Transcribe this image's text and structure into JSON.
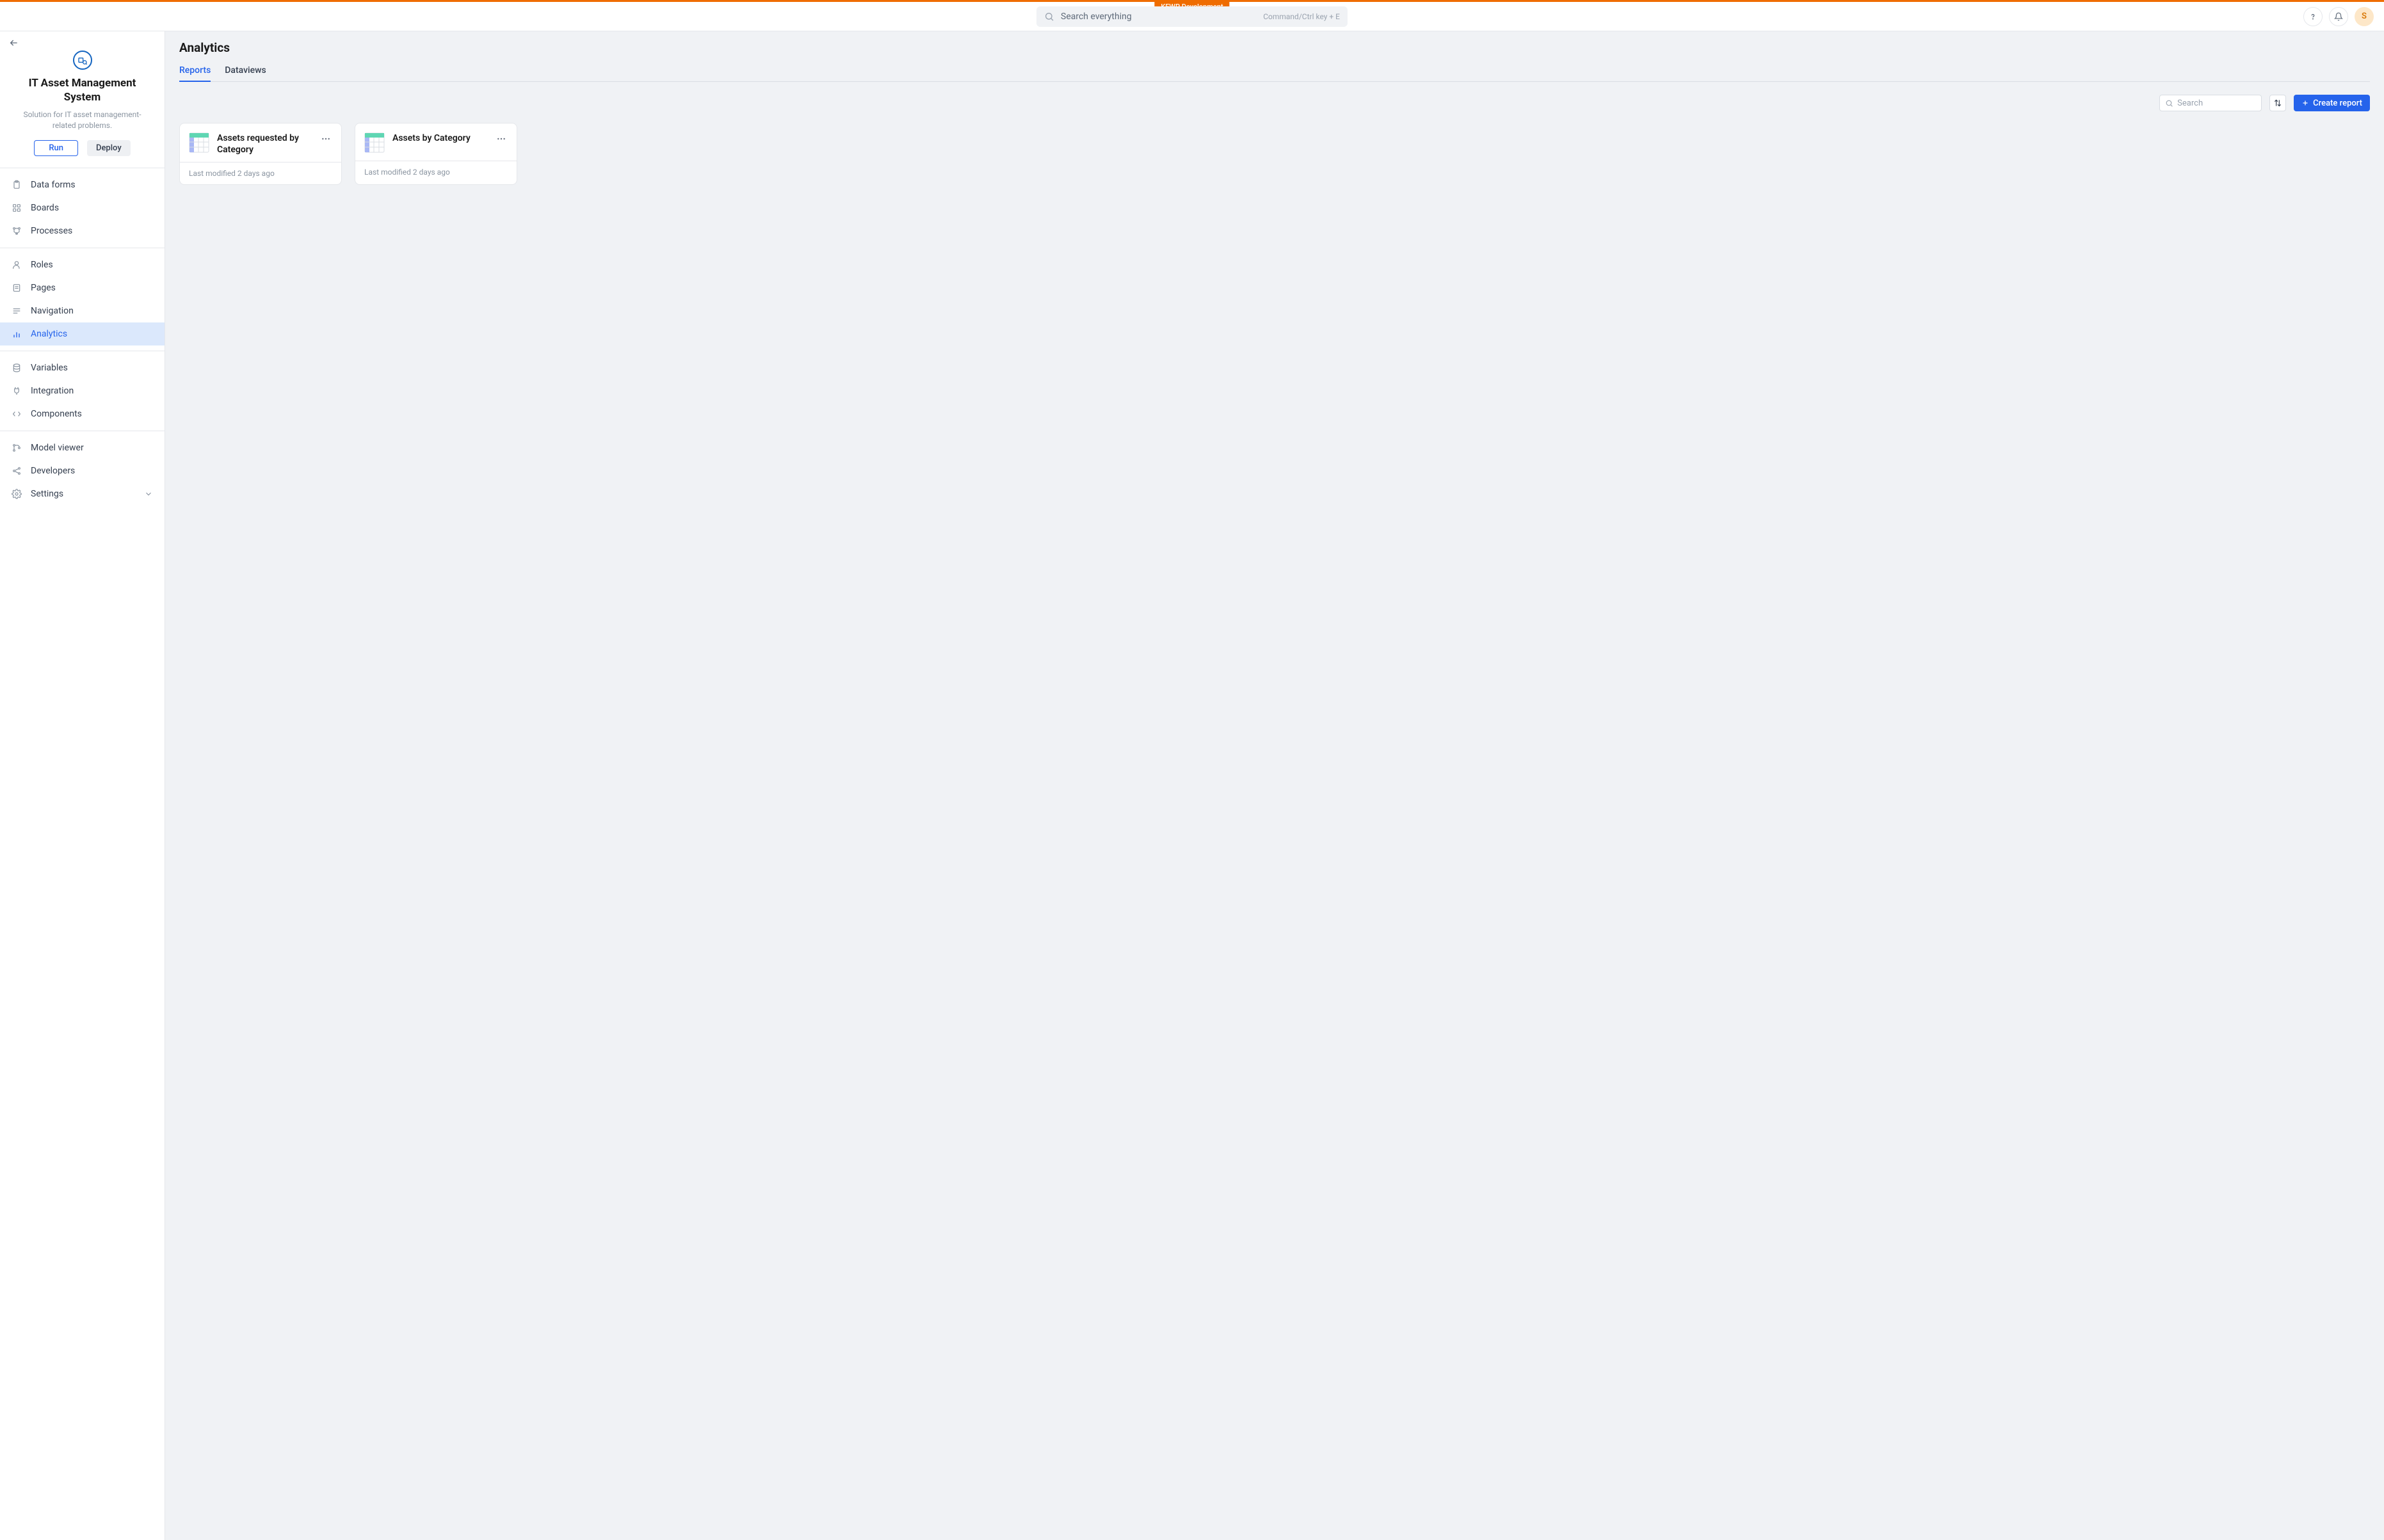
{
  "env_badge": "KFWP Development",
  "header": {
    "search_placeholder": "Search everything",
    "search_hint": "Command/Ctrl key + E",
    "avatar_initial": "S"
  },
  "sidebar": {
    "app_title": "IT Asset Management System",
    "app_subtitle": "Solution for IT asset management-related problems.",
    "run_label": "Run",
    "deploy_label": "Deploy",
    "groups": [
      {
        "items": [
          {
            "key": "data-forms",
            "label": "Data forms"
          },
          {
            "key": "boards",
            "label": "Boards"
          },
          {
            "key": "processes",
            "label": "Processes"
          }
        ]
      },
      {
        "items": [
          {
            "key": "roles",
            "label": "Roles"
          },
          {
            "key": "pages",
            "label": "Pages"
          },
          {
            "key": "navigation",
            "label": "Navigation"
          },
          {
            "key": "analytics",
            "label": "Analytics",
            "active": true
          }
        ]
      },
      {
        "items": [
          {
            "key": "variables",
            "label": "Variables"
          },
          {
            "key": "integration",
            "label": "Integration"
          },
          {
            "key": "components",
            "label": "Components"
          }
        ]
      },
      {
        "items": [
          {
            "key": "model-viewer",
            "label": "Model viewer"
          },
          {
            "key": "developers",
            "label": "Developers"
          },
          {
            "key": "settings",
            "label": "Settings",
            "chevron": true
          }
        ]
      }
    ]
  },
  "main": {
    "title": "Analytics",
    "tabs": [
      {
        "key": "reports",
        "label": "Reports",
        "active": true
      },
      {
        "key": "dataviews",
        "label": "Dataviews"
      }
    ],
    "search_placeholder": "Search",
    "create_label": "Create report",
    "cards": [
      {
        "title": "Assets requested by Category",
        "modified": "Last modified 2 days ago"
      },
      {
        "title": "Assets by Category",
        "modified": "Last modified 2 days ago"
      }
    ]
  }
}
